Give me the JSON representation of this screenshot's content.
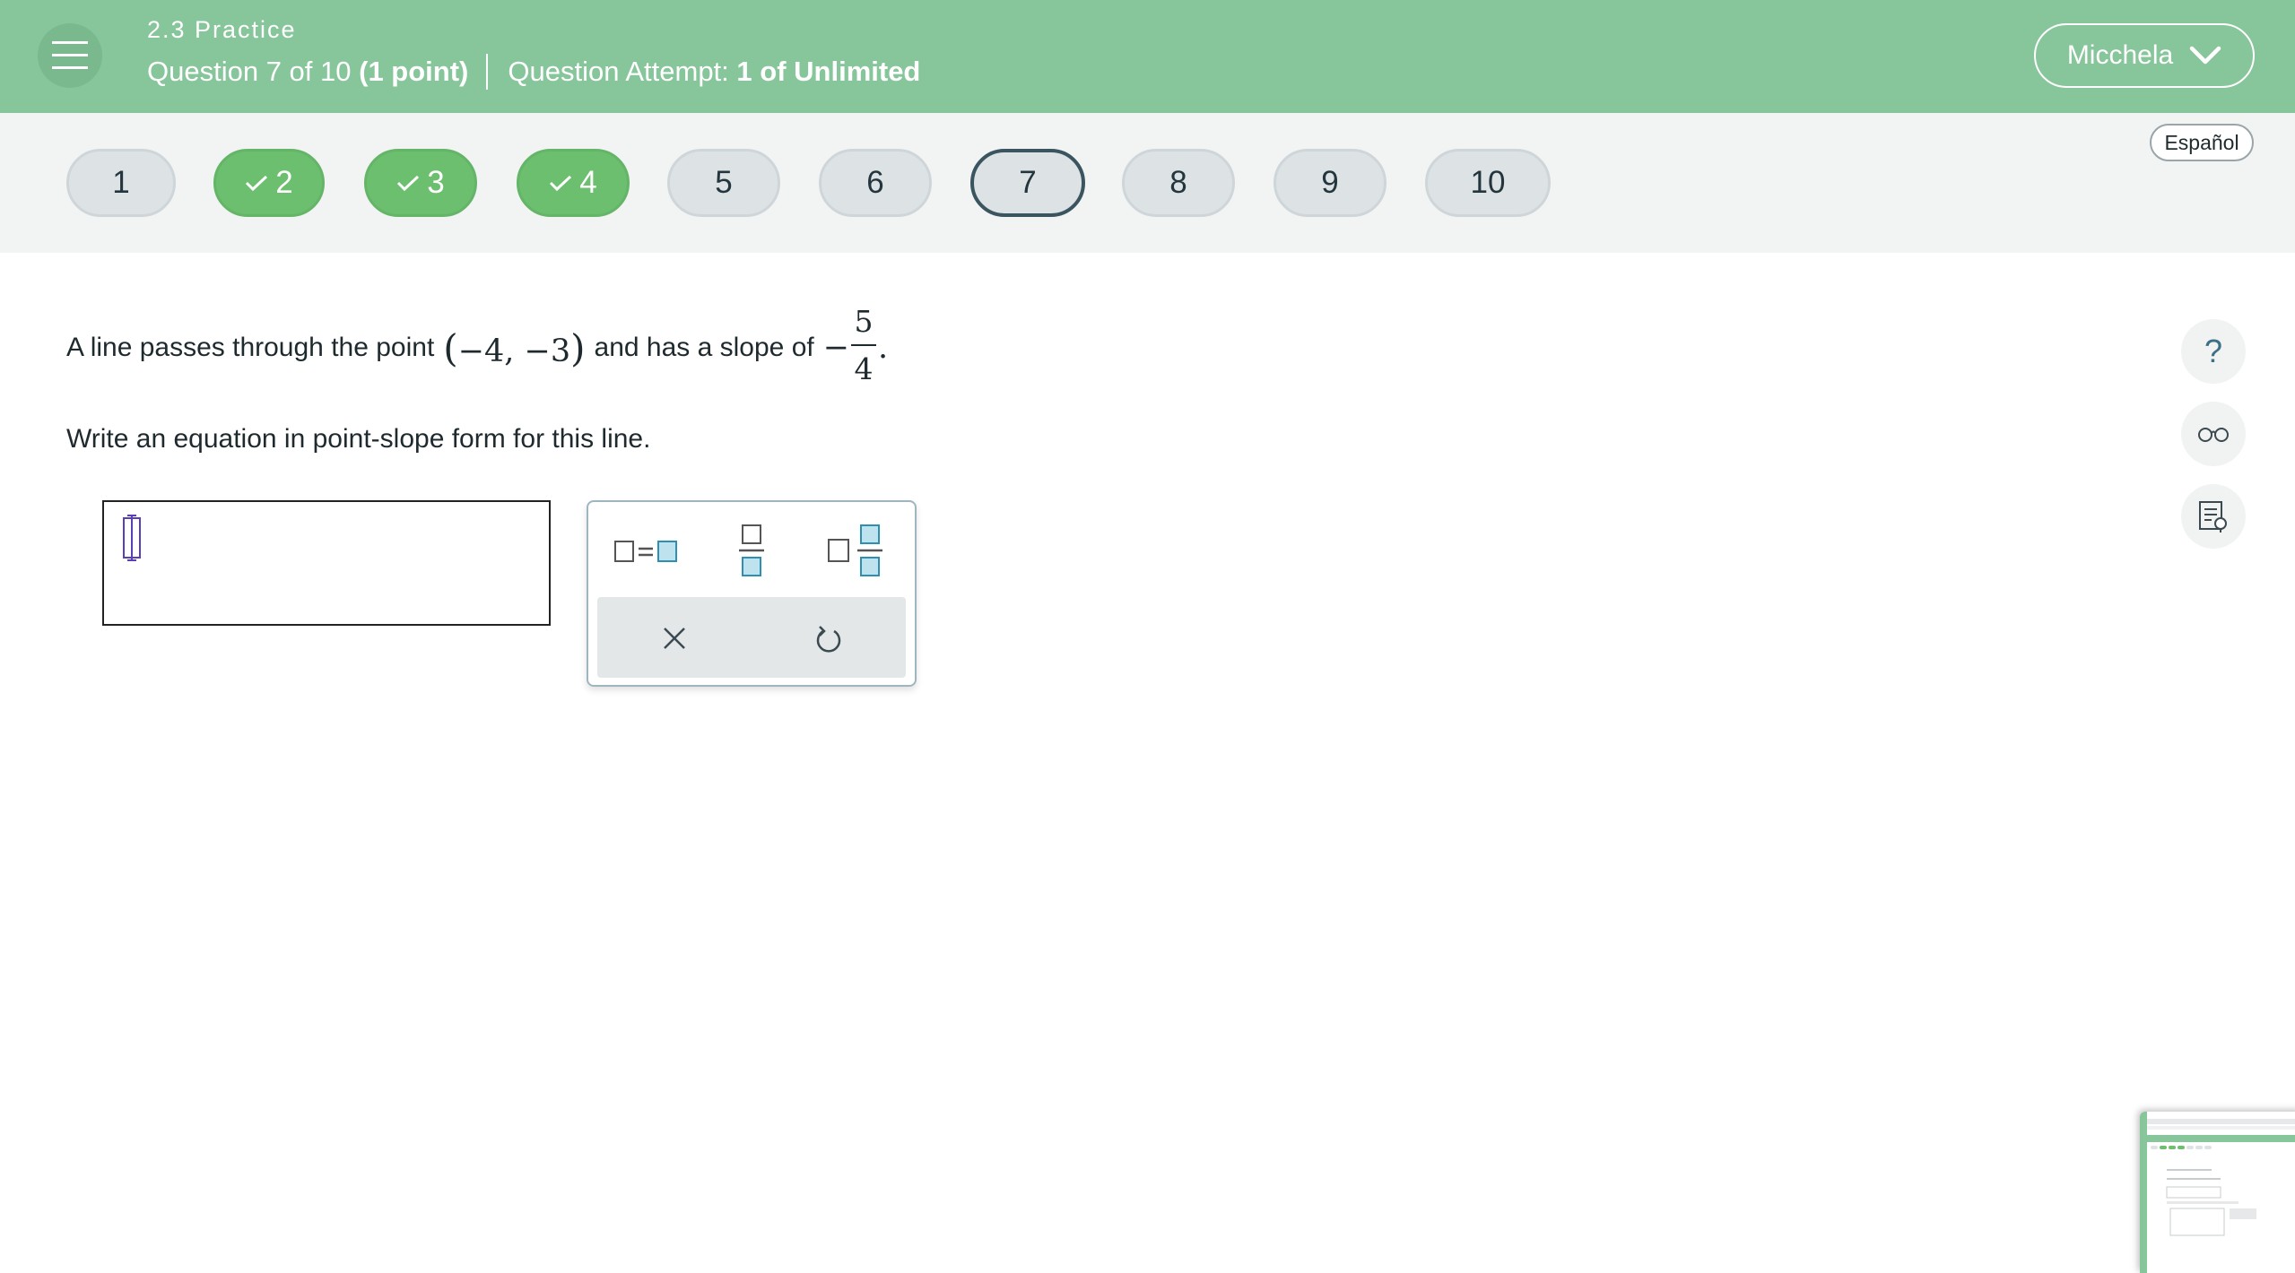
{
  "header": {
    "assignment_title": "2.3 Practice",
    "question_position": "Question 7 of 10",
    "question_points": "(1 point)",
    "attempt_label": "Question Attempt:",
    "attempt_value": "1 of Unlimited",
    "user_name": "Micchela",
    "background_color": "#87c59b"
  },
  "language_button": "Español",
  "question_nav": [
    {
      "label": "1",
      "status": "unanswered"
    },
    {
      "label": "2",
      "status": "completed"
    },
    {
      "label": "3",
      "status": "completed"
    },
    {
      "label": "4",
      "status": "completed"
    },
    {
      "label": "5",
      "status": "unanswered"
    },
    {
      "label": "6",
      "status": "unanswered"
    },
    {
      "label": "7",
      "status": "current"
    },
    {
      "label": "8",
      "status": "unanswered"
    },
    {
      "label": "9",
      "status": "unanswered"
    },
    {
      "label": "10",
      "status": "unanswered"
    }
  ],
  "question": {
    "text_part1": "A line passes through the point",
    "point": "−4, −3",
    "text_part2": "and has a slope of",
    "slope_sign": "−",
    "slope_numerator": "5",
    "slope_denominator": "4",
    "period": ".",
    "instruction": "Write an equation in point-slope form for this line."
  },
  "answer": {
    "value": ""
  },
  "palette": {
    "buttons": [
      "equation-template",
      "fraction-template",
      "mixed-number-template",
      "clear",
      "reset"
    ]
  },
  "tools": [
    "help-icon",
    "reader-glasses-icon",
    "notepad-icon"
  ]
}
